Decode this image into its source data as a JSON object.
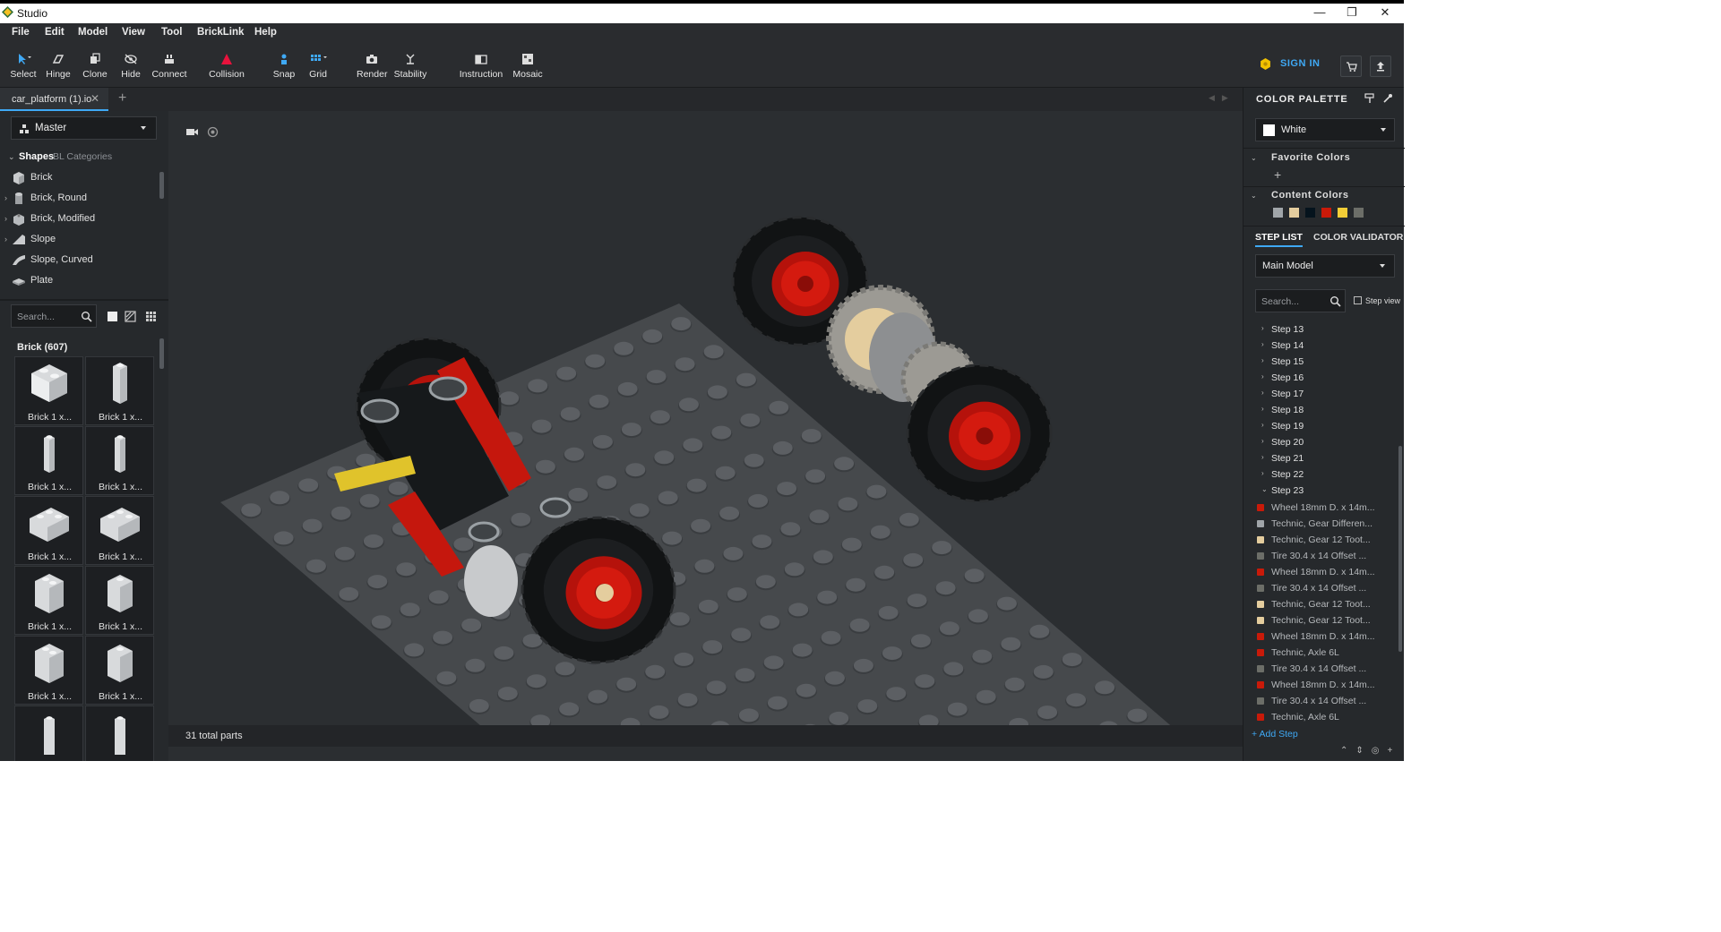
{
  "window": {
    "title": "Studio",
    "controls": [
      "—",
      "❐",
      "✕"
    ]
  },
  "menu": [
    "File",
    "Edit",
    "Model",
    "View",
    "Tool",
    "BrickLink",
    "Help"
  ],
  "toolbar": {
    "tools": [
      "Select",
      "Hinge",
      "Clone",
      "Hide",
      "Connect",
      "Collision",
      "Snap",
      "Grid",
      "Render",
      "Stability",
      "Instruction",
      "Mosaic"
    ],
    "sign_in": "SIGN IN"
  },
  "tabs": {
    "file": "car_platform (1).io",
    "close": "✕",
    "add": "+"
  },
  "left_panel": {
    "master": "Master",
    "tab_shapes": "Shapes",
    "tab_bl": "BL Categories",
    "categories": [
      "Brick",
      "Brick, Round",
      "Brick, Modified",
      "Slope",
      "Slope, Curved",
      "Plate"
    ],
    "search_placeholder": "Search...",
    "parts_title": "Brick (607)",
    "parts": [
      "Brick 1 x...",
      "Brick 1 x...",
      "Brick 1 x...",
      "Brick 1 x...",
      "Brick 1 x...",
      "Brick 1 x...",
      "Brick 1 x...",
      "Brick 1 x...",
      "Brick 1 x...",
      "Brick 1 x..."
    ]
  },
  "viewport": {
    "parts_count": "31 total parts"
  },
  "right_panel": {
    "color_palette_title": "COLOR PALETTE",
    "selected_color": "White",
    "favorite_colors_title": "Favorite Colors",
    "content_colors_title": "Content Colors",
    "content_colors": [
      "#a0a5a9",
      "#e4cd9e",
      "#05131d",
      "#c91a09",
      "#f2cd37",
      "#6c6e68"
    ],
    "tab_step_list": "STEP LIST",
    "tab_color_validator": "COLOR VALIDATOR",
    "model_select": "Main Model",
    "step_search_placeholder": "Search...",
    "step_view_label": "Step view",
    "steps": [
      "Step 13",
      "Step 14",
      "Step 15",
      "Step 16",
      "Step 17",
      "Step 18",
      "Step 19",
      "Step 20",
      "Step 21",
      "Step 22",
      "Step 23"
    ],
    "step23_parts": [
      {
        "name": "Wheel 18mm D. x 14m...",
        "color": "#c91a09"
      },
      {
        "name": "Technic, Gear Differen...",
        "color": "#a0a5a9"
      },
      {
        "name": "Technic, Gear 12 Toot...",
        "color": "#e4cd9e"
      },
      {
        "name": "Tire 30.4 x 14 Offset ...",
        "color": "#6c6e68"
      },
      {
        "name": "Wheel 18mm D. x 14m...",
        "color": "#c91a09"
      },
      {
        "name": "Tire 30.4 x 14 Offset ...",
        "color": "#6c6e68"
      },
      {
        "name": "Technic, Gear 12 Toot...",
        "color": "#e4cd9e"
      },
      {
        "name": "Technic, Gear 12 Toot...",
        "color": "#e4cd9e"
      },
      {
        "name": "Wheel 18mm D. x 14m...",
        "color": "#c91a09"
      },
      {
        "name": "Technic, Axle  6L",
        "color": "#c91a09"
      },
      {
        "name": "Tire 30.4 x 14 Offset ...",
        "color": "#6c6e68"
      },
      {
        "name": "Wheel 18mm D. x 14m...",
        "color": "#c91a09"
      },
      {
        "name": "Tire 30.4 x 14 Offset ...",
        "color": "#6c6e68"
      },
      {
        "name": "Technic, Axle  6L",
        "color": "#c91a09"
      }
    ],
    "add_step": "+ Add Step"
  },
  "colors": {
    "accent": "#3fa9f5",
    "background": "#1f2225",
    "sign_in_coin": "#f2c100",
    "collision_icon": "#e8123c"
  }
}
